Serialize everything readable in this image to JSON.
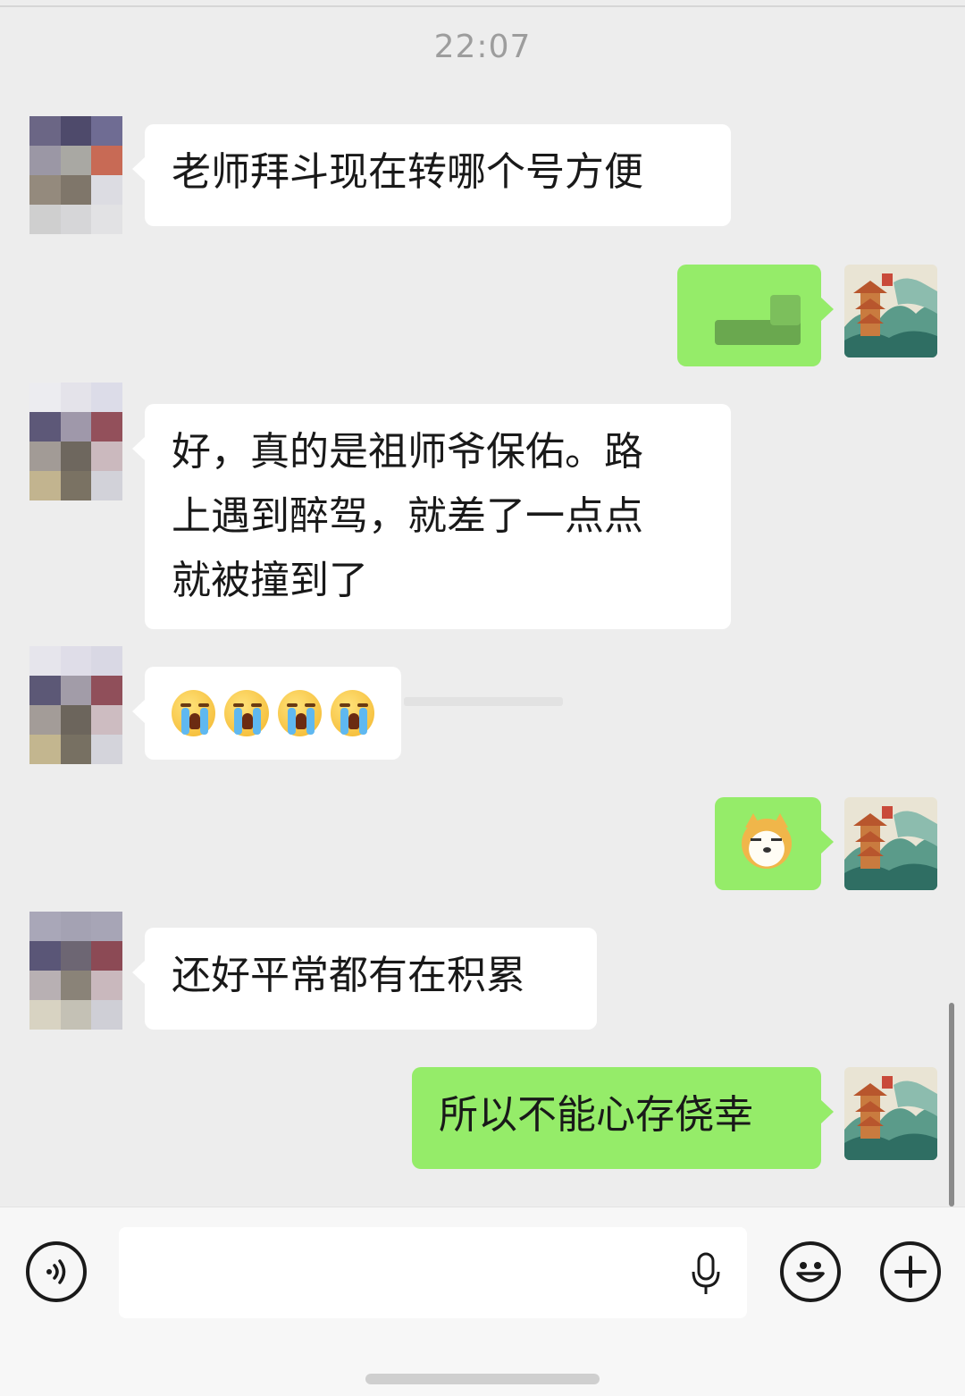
{
  "chat": {
    "timestamp": "22:07",
    "messages": [
      {
        "side": "left",
        "text": "老师拜斗现在转哪个号方便"
      },
      {
        "side": "right",
        "content": "blurred"
      },
      {
        "side": "left",
        "lines": [
          "好，真的是祖师爷保佑。路",
          "上遇到醉驾，就差了一点点",
          "就被撞到了"
        ]
      },
      {
        "side": "left",
        "emoji": "crying-face",
        "emoji_count": 4
      },
      {
        "side": "right",
        "emoji": "doge"
      },
      {
        "side": "left",
        "text": "还好平常都有在积累"
      },
      {
        "side": "right",
        "text": "所以不能心存侥幸"
      }
    ]
  },
  "input_bar": {
    "voice_icon": "voice-icon",
    "mic_icon": "microphone-icon",
    "emoji_icon": "smiley-icon",
    "plus_icon": "plus-icon",
    "input_value": ""
  },
  "colors": {
    "background": "#ededed",
    "incoming_bubble": "#ffffff",
    "outgoing_bubble": "#95ec69"
  }
}
